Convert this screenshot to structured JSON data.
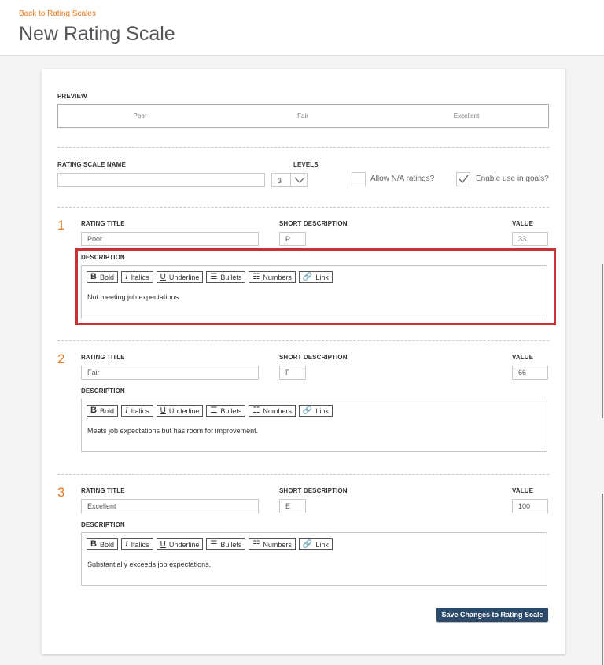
{
  "header": {
    "back_link": "Back to Rating Scales",
    "title": "New Rating Scale"
  },
  "preview": {
    "label": "PREVIEW",
    "items": [
      "Poor",
      "Fair",
      "Excellent"
    ]
  },
  "settings": {
    "name_label": "RATING SCALE NAME",
    "name_value": "",
    "levels_label": "LEVELS",
    "levels_value": "3",
    "allow_na_label": "Allow N/A ratings?",
    "allow_na_checked": false,
    "enable_goals_label": "Enable use in goals?",
    "enable_goals_checked": true
  },
  "labels": {
    "rating_title": "RATING TITLE",
    "short_description": "SHORT DESCRIPTION",
    "value": "VALUE",
    "description": "DESCRIPTION"
  },
  "toolbar": {
    "bold": "Bold",
    "italics": "Italics",
    "underline": "Underline",
    "bullets": "Bullets",
    "numbers": "Numbers",
    "link": "Link"
  },
  "ratings": [
    {
      "number": "1",
      "title": "Poor",
      "short": "P",
      "value": "33",
      "description": "Not meeting job expectations."
    },
    {
      "number": "2",
      "title": "Fair",
      "short": "F",
      "value": "66",
      "description": "Meets job expectations but has room for improvement."
    },
    {
      "number": "3",
      "title": "Excellent",
      "short": "E",
      "value": "100",
      "description": "Substantially exceeds job expectations."
    }
  ],
  "save_button": "Save Changes to Rating Scale",
  "colors": {
    "accent": "#e8781e",
    "button": "#2b4a6a",
    "highlight": "#c73232"
  }
}
